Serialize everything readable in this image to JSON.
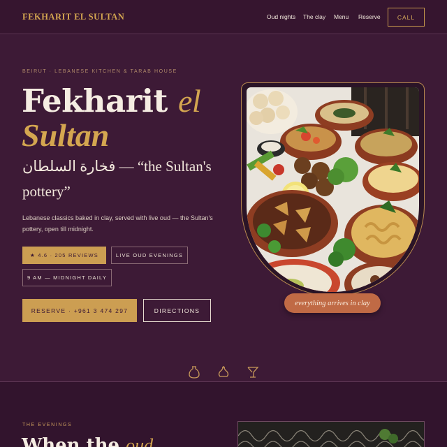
{
  "nav": {
    "brand": "FEKHARIT EL SULTAN",
    "links": [
      "Oud nights",
      "The clay",
      "Menu",
      "Reserve"
    ],
    "call_label": "CALL"
  },
  "hero": {
    "kicker": "BEIRUT · LEBANESE KITCHEN & TARAB HOUSE",
    "title_part1": "Fekharit",
    "title_part2": "el",
    "title_line2": "Sultan",
    "subtitle": "فخارة السلطان — “the Sultan's pottery”",
    "description": "Lebanese classics baked in clay, served with live oud — the Sultan's pottery, open till midnight.",
    "rating_chip": "★ 4.6 · 205 REVIEWS",
    "oud_chip": "LIVE OUD EVENINGS",
    "hours_chip": "9 AM — MIDNIGHT DAILY",
    "reserve_label": "RESERVE · +961 3 474 297",
    "directions_label": "DIRECTIONS",
    "badge": "everything arrives in clay"
  },
  "divider_icons": [
    "clay-pot-icon",
    "jug-icon",
    "goblet-icon"
  ],
  "evenings": {
    "kicker": "THE EVENINGS",
    "heading_part1": "When the",
    "heading_part2": "oud"
  },
  "colors": {
    "background": "#3d1a36",
    "gold": "#d4a650",
    "clay": "#c06a45"
  }
}
